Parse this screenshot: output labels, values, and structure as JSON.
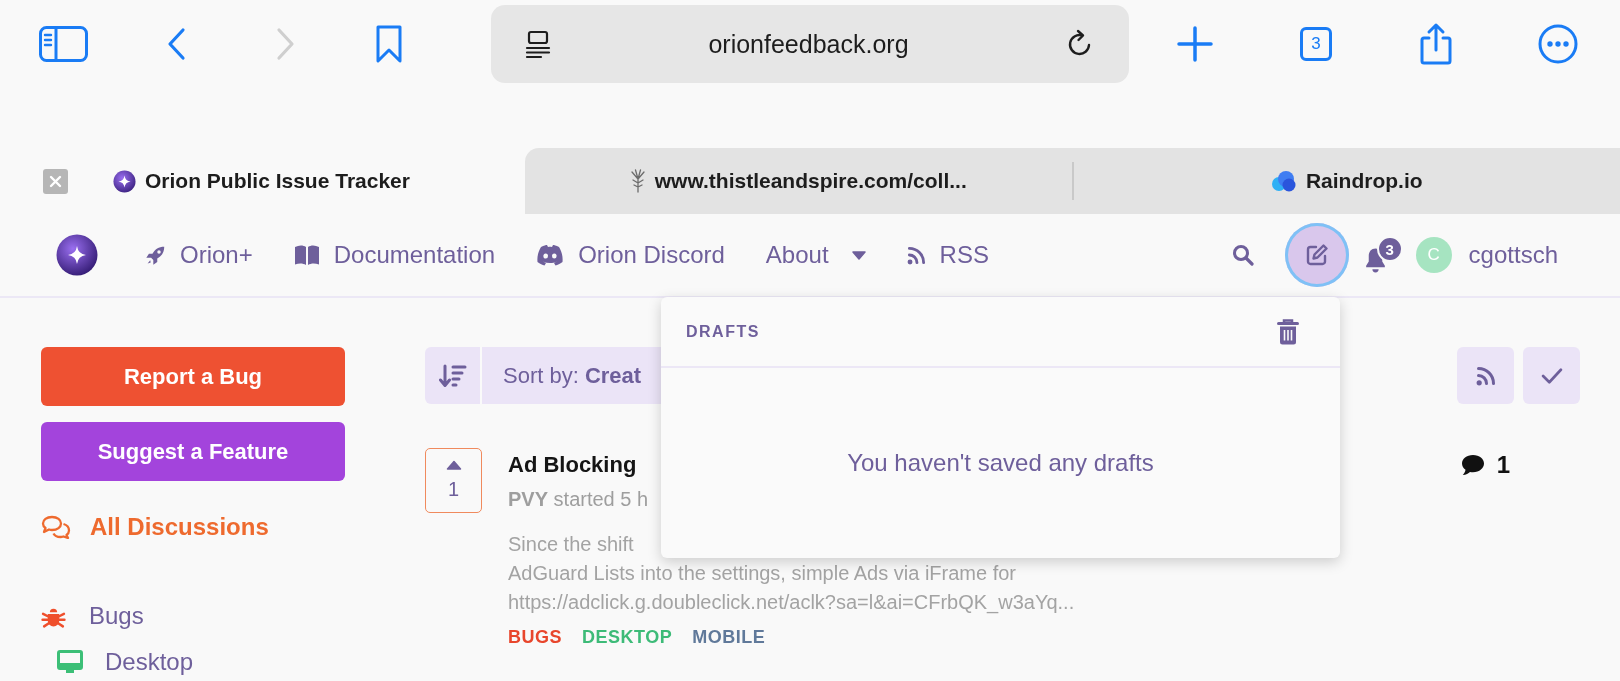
{
  "browser": {
    "back": {
      "disabled": false
    },
    "forward": {
      "disabled": true
    },
    "address": "orionfeedback.org",
    "tab_count": "3",
    "tabs": [
      {
        "title": "Orion Public Issue Tracker",
        "selected": true
      },
      {
        "title": "www.thistleandspire.com/coll...",
        "selected": false
      },
      {
        "title": "Raindrop.io",
        "selected": false
      }
    ]
  },
  "site_nav": {
    "links": [
      {
        "kind": "link",
        "label": "Orion+"
      },
      {
        "kind": "link",
        "label": "Documentation"
      },
      {
        "kind": "link",
        "label": "Orion Discord"
      },
      {
        "kind": "dropdown",
        "label": "About"
      },
      {
        "kind": "link",
        "label": "RSS"
      }
    ],
    "compose": {
      "expanded": true
    },
    "notification_count": "3",
    "avatar_initial": "C",
    "username": "cgottsch"
  },
  "drafts_popover": {
    "title": "DRAFTS",
    "empty_message": "You haven't saved any drafts"
  },
  "sidebar": {
    "buttons": [
      "Report a Bug",
      "Suggest a Feature"
    ],
    "items": [
      {
        "label": "All Discussions",
        "selected": true
      },
      {
        "label": "Bugs",
        "selected": false,
        "color": "#ef4f2c",
        "children": [
          {
            "label": "Desktop",
            "selected": false,
            "color": "#3cbf77"
          }
        ]
      }
    ]
  },
  "sort": {
    "label": "Sort by: **Creat**"
  },
  "discussions": [
    {
      "votes": "1",
      "title": "Ad Blocking",
      "meta": "**PVY** started 5 h",
      "excerpt": [
        "Since the shift",
        "AdGuard Lists into the settings, simple Ads via iFrame for",
        "https://adclick.g.doubleclick.net/aclk?sa=l&ai=CFrbQK_w3aYq..."
      ],
      "tags": [
        {
          "label": "BUGS",
          "color": "#e8462c"
        },
        {
          "label": "DESKTOP",
          "color": "#3dbb78"
        },
        {
          "label": "MOBILE",
          "color": "#60799a"
        }
      ],
      "replies": "1"
    }
  ]
}
